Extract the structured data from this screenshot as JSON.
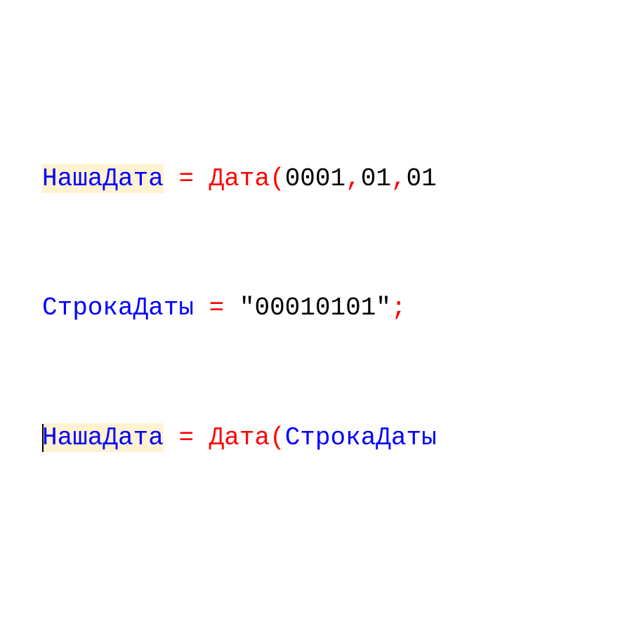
{
  "code": {
    "line1": {
      "var": "НашаДата",
      "op": "=",
      "func": "Дата",
      "lparen": "(",
      "arg1": "0001",
      "comma1": ",",
      "arg2": "01",
      "comma2": ",",
      "arg3": "01"
    },
    "line2": {
      "var": "СтрокаДаты",
      "op": "=",
      "str": "\"00010101\"",
      "semi": ";"
    },
    "line3": {
      "var": "НашаДата",
      "op": "=",
      "func": "Дата",
      "lparen": "(",
      "arg1": "СтрокаДаты"
    }
  }
}
